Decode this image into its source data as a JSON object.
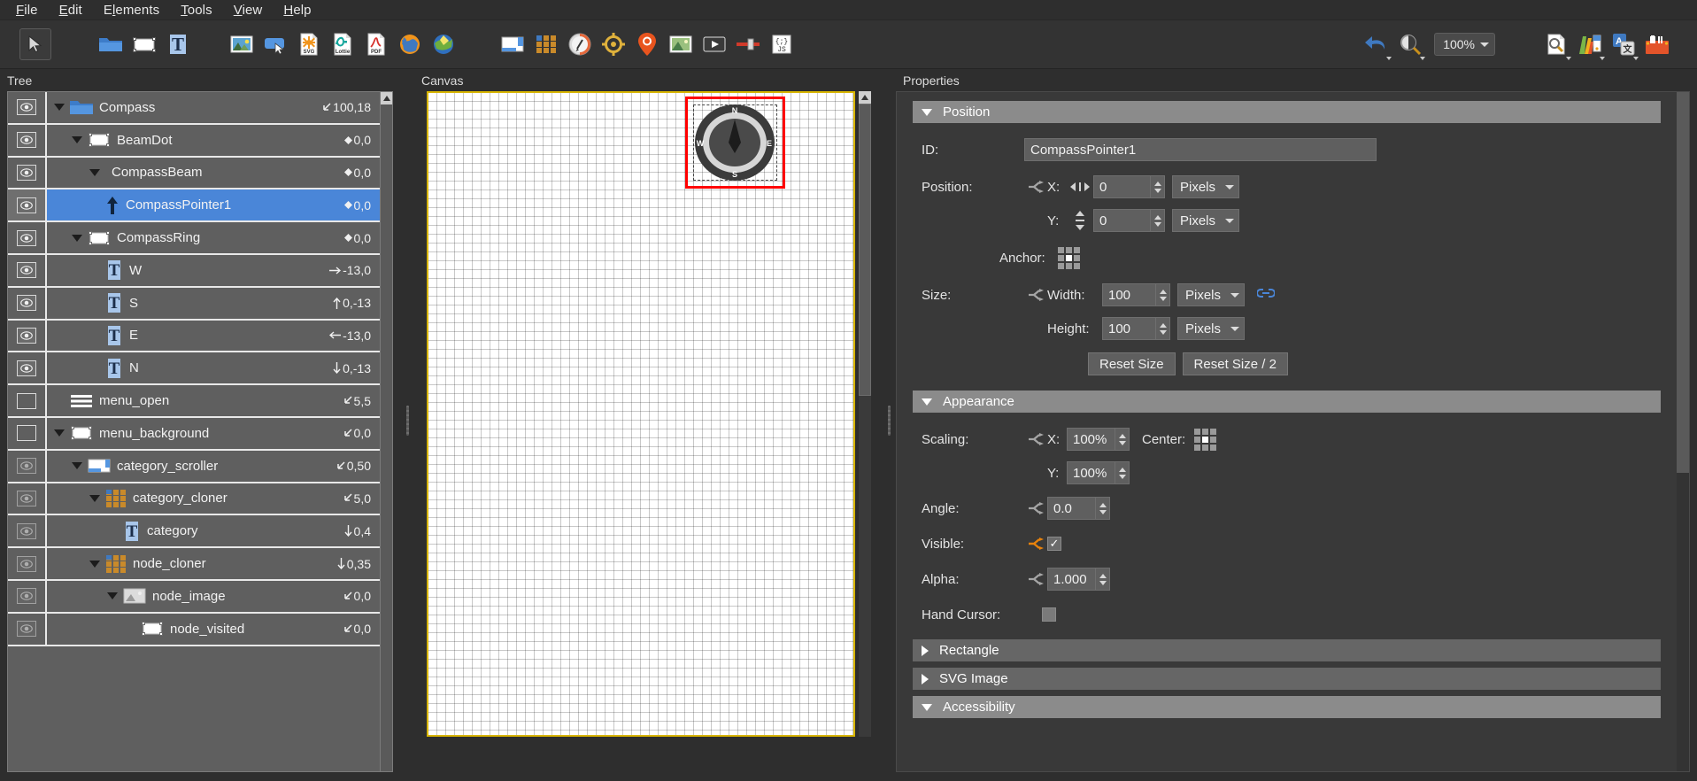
{
  "menubar": {
    "items": [
      {
        "pre": "",
        "accel": "F",
        "post": "ile"
      },
      {
        "pre": "",
        "accel": "E",
        "post": "dit"
      },
      {
        "pre": "E",
        "accel": "l",
        "post": "ements"
      },
      {
        "pre": "",
        "accel": "T",
        "post": "ools"
      },
      {
        "pre": "",
        "accel": "V",
        "post": "iew"
      },
      {
        "pre": "",
        "accel": "H",
        "post": "elp"
      }
    ],
    "labels": [
      "File",
      "Edit",
      "Elements",
      "Tools",
      "View",
      "Help"
    ]
  },
  "toolbar": {
    "tools": [
      {
        "name": "select-tool",
        "title": "Select"
      },
      {
        "name": "folder-tool",
        "title": "Folder"
      },
      {
        "name": "rectangle-tool",
        "title": "Rectangle"
      },
      {
        "name": "text-tool",
        "title": "Text"
      },
      {
        "name": "image-tool",
        "title": "Image"
      },
      {
        "name": "button-tool",
        "title": "Button"
      },
      {
        "name": "svg-tool",
        "title": "SVG"
      },
      {
        "name": "lottie-tool",
        "title": "Lottie"
      },
      {
        "name": "pdf-tool",
        "title": "PDF"
      },
      {
        "name": "web-tool",
        "title": "Web"
      },
      {
        "name": "map-tool",
        "title": "Map"
      },
      {
        "name": "screen-tool",
        "title": "Screen"
      },
      {
        "name": "cloner-tool",
        "title": "Cloner"
      },
      {
        "name": "compass-tool",
        "title": "Compass"
      },
      {
        "name": "target-tool",
        "title": "Target"
      },
      {
        "name": "marker-tool",
        "title": "Marker"
      },
      {
        "name": "photo-tool",
        "title": "Photo"
      },
      {
        "name": "video-tool",
        "title": "Video"
      },
      {
        "name": "slider-tool",
        "title": "Slider"
      },
      {
        "name": "script-tool",
        "title": "Script"
      }
    ],
    "right_tools": [
      {
        "name": "undo-button",
        "title": "Undo"
      },
      {
        "name": "zoom-button",
        "title": "Zoom"
      }
    ],
    "zoom_value": "100%",
    "far_right_tools": [
      {
        "name": "inspect-button",
        "title": "Inspect"
      },
      {
        "name": "palette-button",
        "title": "Palette"
      },
      {
        "name": "translate-button",
        "title": "Translate"
      },
      {
        "name": "toolbox-button",
        "title": "Toolbox"
      }
    ]
  },
  "tree": {
    "title": "Tree",
    "rows": [
      {
        "label": "Compass",
        "value": "100,18",
        "badge": "arrow-sw",
        "indent": 0,
        "caret": "down",
        "icon": "folder",
        "eye": "on"
      },
      {
        "label": "BeamDot",
        "value": "0,0",
        "badge": "diamond",
        "indent": 1,
        "caret": "down",
        "icon": "rect",
        "eye": "on"
      },
      {
        "label": "CompassBeam",
        "value": "0,0",
        "badge": "diamond",
        "indent": 2,
        "caret": "down",
        "icon": "none",
        "eye": "on"
      },
      {
        "label": "CompassPointer1",
        "value": "0,0",
        "badge": "diamond",
        "indent": 2,
        "caret": "none",
        "icon": "arrow-up",
        "eye": "on",
        "selected": true
      },
      {
        "label": "CompassRing",
        "value": "0,0",
        "badge": "diamond",
        "indent": 1,
        "caret": "down",
        "icon": "rect",
        "eye": "on"
      },
      {
        "label": "W",
        "value": "-13,0",
        "badge": "arrow-right",
        "indent": 2,
        "caret": "none",
        "icon": "text",
        "eye": "on"
      },
      {
        "label": "S",
        "value": "0,-13",
        "badge": "arrow-up",
        "indent": 2,
        "caret": "none",
        "icon": "text",
        "eye": "on"
      },
      {
        "label": "E",
        "value": "-13,0",
        "badge": "arrow-left",
        "indent": 2,
        "caret": "none",
        "icon": "text",
        "eye": "on"
      },
      {
        "label": "N",
        "value": "0,-13",
        "badge": "arrow-down",
        "indent": 2,
        "caret": "none",
        "icon": "text",
        "eye": "on"
      },
      {
        "label": "menu_open",
        "value": "5,5",
        "badge": "arrow-sw",
        "indent": 0,
        "caret": "none",
        "icon": "hamburger",
        "eye": "off"
      },
      {
        "label": "menu_background",
        "value": "0,0",
        "badge": "arrow-sw",
        "indent": 0,
        "caret": "down",
        "icon": "rect",
        "eye": "off"
      },
      {
        "label": "category_scroller",
        "value": "0,50",
        "badge": "arrow-sw",
        "indent": 1,
        "caret": "down",
        "icon": "scroller",
        "eye": "dim"
      },
      {
        "label": "category_cloner",
        "value": "5,0",
        "badge": "arrow-sw",
        "indent": 2,
        "caret": "down",
        "icon": "cloner",
        "eye": "dim"
      },
      {
        "label": "category",
        "value": "0,4",
        "badge": "arrow-down",
        "indent": 3,
        "caret": "none",
        "icon": "text",
        "eye": "dim"
      },
      {
        "label": "node_cloner",
        "value": "0,35",
        "badge": "arrow-down",
        "indent": 2,
        "caret": "down",
        "icon": "cloner",
        "eye": "dim"
      },
      {
        "label": "node_image",
        "value": "0,0",
        "badge": "arrow-sw",
        "indent": 3,
        "caret": "down",
        "icon": "image",
        "eye": "dim"
      },
      {
        "label": "node_visited",
        "value": "0,0",
        "badge": "arrow-sw",
        "indent": 4,
        "caret": "none",
        "icon": "rect",
        "eye": "dim"
      }
    ]
  },
  "canvas": {
    "title": "Canvas",
    "compass": {
      "n": "N",
      "e": "E",
      "s": "S",
      "w": "W"
    }
  },
  "properties": {
    "title": "Properties",
    "sections": {
      "position": {
        "label": "Position",
        "id_label": "ID:",
        "id_value": "CompassPointer1",
        "position_label": "Position:",
        "x_label": "X:",
        "x_value": "0",
        "x_unit": "Pixels",
        "y_label": "Y:",
        "y_value": "0",
        "y_unit": "Pixels",
        "anchor_label": "Anchor:",
        "size_label": "Size:",
        "width_label": "Width:",
        "width_value": "100",
        "width_unit": "Pixels",
        "height_label": "Height:",
        "height_value": "100",
        "height_unit": "Pixels",
        "reset_size": "Reset Size",
        "reset_size_half": "Reset Size / 2"
      },
      "appearance": {
        "label": "Appearance",
        "scaling_label": "Scaling:",
        "scale_x_label": "X:",
        "scale_x_value": "100%",
        "scale_y_label": "Y:",
        "scale_y_value": "100%",
        "center_label": "Center:",
        "angle_label": "Angle:",
        "angle_value": "0.0",
        "visible_label": "Visible:",
        "visible_checked": "✓",
        "alpha_label": "Alpha:",
        "alpha_value": "1.000",
        "hand_cursor_label": "Hand Cursor:"
      },
      "rectangle": {
        "label": "Rectangle"
      },
      "svg_image": {
        "label": "SVG Image"
      },
      "accessibility": {
        "label": "Accessibility"
      }
    }
  },
  "colors": {
    "accent_blue": "#4a86d8",
    "selection_red": "#ff0000",
    "canvas_border": "#d8b500",
    "orange_anim": "#e8820c",
    "panel_bg": "#2e2e2e",
    "tree_row": "#5f5f5f"
  }
}
